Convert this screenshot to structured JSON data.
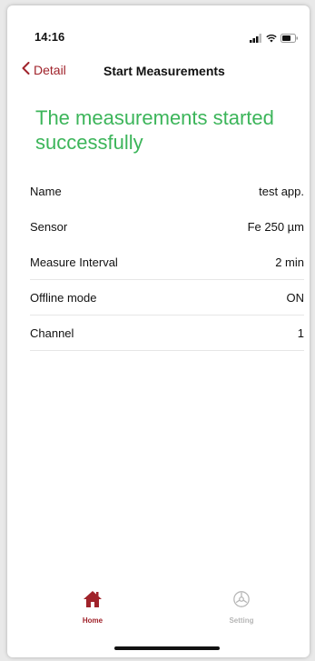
{
  "status_bar": {
    "time": "14:16",
    "icons": [
      "signal-icon",
      "wifi-icon",
      "battery-icon"
    ]
  },
  "nav": {
    "back_label": "Detail",
    "title": "Start Measurements"
  },
  "headline": "The measurements started successfully",
  "details": [
    {
      "label": "Name",
      "value": "test app."
    },
    {
      "label": "Sensor",
      "value": "Fe 250 µm"
    },
    {
      "label": "Measure Interval",
      "value": "2 min"
    },
    {
      "label": "Offline mode",
      "value": "ON"
    },
    {
      "label": "Channel",
      "value": "1"
    }
  ],
  "tabs": [
    {
      "label": "Home",
      "icon": "home-icon",
      "active": true
    },
    {
      "label": "Setting",
      "icon": "gear-icon",
      "active": false
    }
  ],
  "colors": {
    "accent": "#a0232b",
    "success": "#3cb55a",
    "inactive": "#b6b6b6"
  }
}
